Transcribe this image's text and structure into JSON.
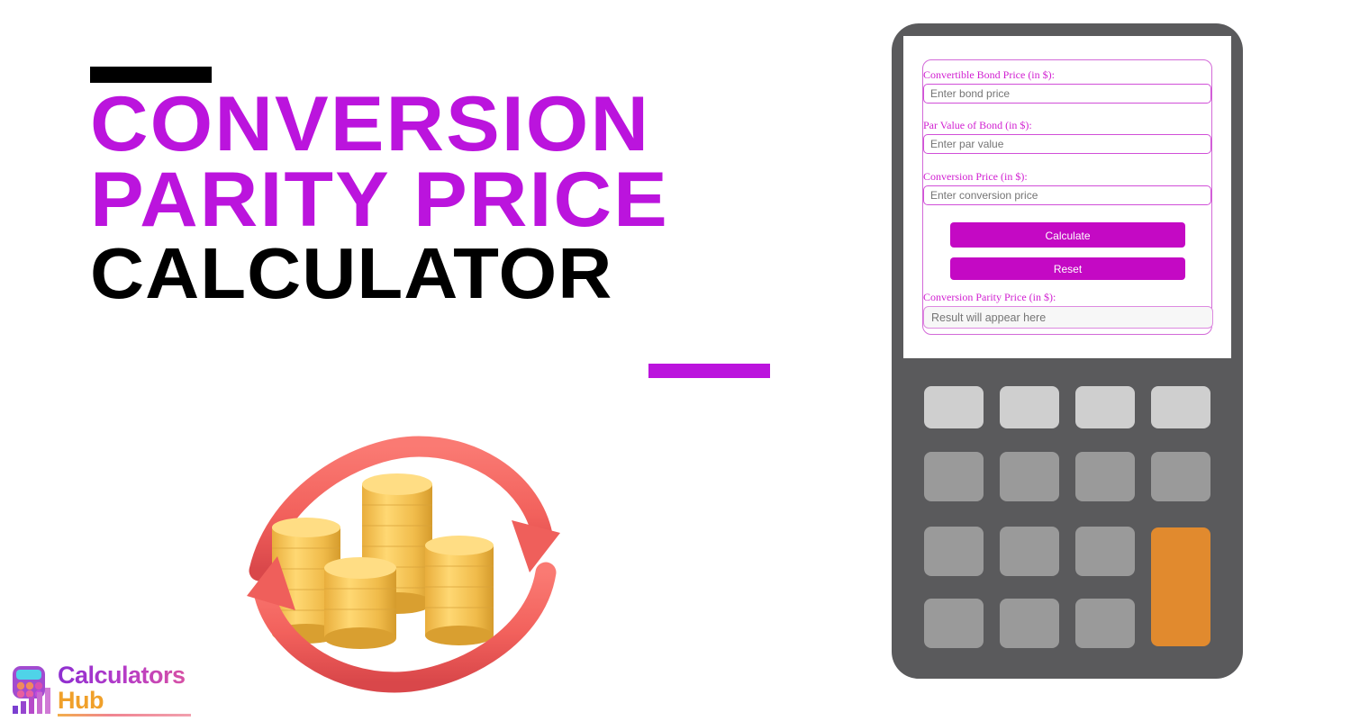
{
  "page": {
    "background": "#ffffff",
    "accent_magenta": "#bb14dd",
    "accent_black": "#000000"
  },
  "hero": {
    "title_line1": "CONVERSION",
    "title_line2": "PARITY PRICE",
    "title_line3": "CALCULATOR",
    "title_line1_color": "#bb14dd",
    "title_line2_color": "#bb14dd",
    "title_line3_color": "#000000",
    "illustration_name": "gold-coin-stacks-with-circular-conversion-arrows"
  },
  "logo": {
    "text_primary": "Calculators",
    "text_secondary": "Hub",
    "primary_color": "#b43bc8",
    "secondary_color": "#f0a02a",
    "icon_name": "calculator-bar-chart-logo-icon"
  },
  "calculator": {
    "body_color": "#5a5a5c",
    "screen_color": "#ffffff",
    "form": {
      "fields": [
        {
          "label": "Convertible Bond Price (in $):",
          "placeholder": "Enter bond price",
          "value": ""
        },
        {
          "label": "Par Value of Bond (in $):",
          "placeholder": "Enter par value",
          "value": ""
        },
        {
          "label": "Conversion Price (in $):",
          "placeholder": "Enter conversion price",
          "value": ""
        }
      ],
      "buttons": {
        "calculate_label": "Calculate",
        "reset_label": "Reset",
        "color": "#c409c4",
        "text_color": "#ffffff"
      },
      "result": {
        "label": "Conversion Parity Price (in $):",
        "placeholder": "Result will appear here",
        "value": ""
      }
    },
    "keypad": {
      "rows": 4,
      "columns": 4,
      "top_row_color": "#cfcfcf",
      "key_color": "#9a9a9a",
      "accent_key_color": "#e18a2e",
      "accent_key_name": "equals-key"
    }
  }
}
